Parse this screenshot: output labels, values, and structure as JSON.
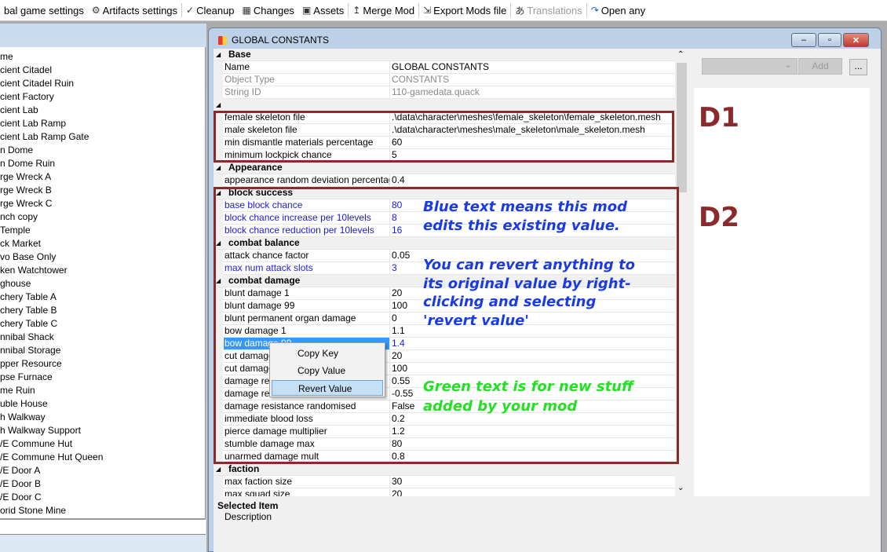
{
  "toolbar": [
    {
      "label": "bal game settings",
      "icon": "settings-icon",
      "enabled": true
    },
    {
      "label": "Artifacts settings",
      "icon": "artifact-icon",
      "enabled": true
    },
    {
      "label": "Cleanup",
      "icon": "broom-icon",
      "enabled": true
    },
    {
      "label": "Changes",
      "icon": "changes-icon",
      "enabled": true
    },
    {
      "label": "Assets",
      "icon": "assets-icon",
      "enabled": true
    },
    {
      "label": "Merge Mod",
      "icon": "merge-icon",
      "enabled": true
    },
    {
      "label": "Export Mods file",
      "icon": "export-icon",
      "enabled": true
    },
    {
      "label": "Translations",
      "icon": "translate-icon",
      "enabled": false
    },
    {
      "label": "Open any",
      "icon": "open-icon",
      "enabled": true
    }
  ],
  "left_list": [
    "me",
    "cient Citadel",
    "cient Citadel Ruin",
    "cient Factory",
    "cient Lab",
    "cient Lab Ramp",
    "cient Lab Ramp Gate",
    "n Dome",
    "n Dome Ruin",
    "rge Wreck A",
    "rge Wreck B",
    "rge Wreck C",
    "nch copy",
    " Temple",
    "ck Market",
    "vo Base Only",
    "ken Watchtower",
    "ghouse",
    "chery Table A",
    "chery Table B",
    "chery Table C",
    "nnibal Shack",
    "nnibal Storage",
    "pper Resource",
    "pse Furnace",
    "me Ruin",
    "uble House",
    "h Walkway",
    "h Walkway Support",
    "/E Commune Hut",
    "/E Commune Hut Queen",
    "/E Door A",
    "/E Door B",
    "/E Door C",
    "orid Stone Mine"
  ],
  "window": {
    "title": "GLOBAL CONSTANTS",
    "min": "–",
    "max": "▫",
    "close": "✕"
  },
  "grid": [
    {
      "cat": true,
      "name": "Base"
    },
    {
      "name": "Name",
      "value": "GLOBAL CONSTANTS"
    },
    {
      "name": "Object Type",
      "value": "CONSTANTS",
      "style": "gray"
    },
    {
      "name": "String ID",
      "value": "110-gamedata.quack",
      "style": "gray"
    },
    {
      "cat": true,
      "name": ""
    },
    {
      "name": "female skeleton file",
      "value": ".\\data\\character\\meshes\\female_skeleton\\female_skeleton.mesh"
    },
    {
      "name": "male skeleton file",
      "value": ".\\data\\character\\meshes\\male_skeleton\\male_skeleton.mesh"
    },
    {
      "name": "min dismantle materials percentage",
      "value": "60"
    },
    {
      "name": "minimum lockpick chance",
      "value": "5"
    },
    {
      "cat": true,
      "name": "Appearance"
    },
    {
      "name": "appearance random deviation percentage",
      "value": "0.4"
    },
    {
      "cat": true,
      "name": "block success"
    },
    {
      "name": "base block chance",
      "value": "80",
      "style": "blue"
    },
    {
      "name": "block chance increase per 10levels",
      "value": "8",
      "style": "blue"
    },
    {
      "name": "block chance reduction per 10levels",
      "value": "16",
      "style": "blue"
    },
    {
      "cat": true,
      "name": "combat balance"
    },
    {
      "name": "attack chance factor",
      "value": "0.05"
    },
    {
      "name": "max num attack slots",
      "value": "3",
      "style": "blue"
    },
    {
      "cat": true,
      "name": "combat damage"
    },
    {
      "name": "blunt damage 1",
      "value": "20"
    },
    {
      "name": "blunt damage 99",
      "value": "100"
    },
    {
      "name": "blunt permanent organ damage",
      "value": "0"
    },
    {
      "name": "bow damage 1",
      "value": "1.1"
    },
    {
      "name": "bow damage 99",
      "value": "1.4",
      "style": "blue",
      "selected": true
    },
    {
      "name": "cut damage",
      "value": "20"
    },
    {
      "name": "cut damage",
      "value": "100"
    },
    {
      "name": "damage resi",
      "value": "0.55"
    },
    {
      "name": "damage resi",
      "value": "-0.55"
    },
    {
      "name": "damage resistance randomised",
      "value": "False"
    },
    {
      "name": "immediate blood loss",
      "value": "0.2"
    },
    {
      "name": "pierce damage multiplier",
      "value": "1.2"
    },
    {
      "name": "stumble damage max",
      "value": "80"
    },
    {
      "name": "unarmed damage mult",
      "value": "0.8"
    },
    {
      "cat": true,
      "name": "faction"
    },
    {
      "name": "max faction size",
      "value": "30"
    },
    {
      "name": "max squad size",
      "value": "20"
    }
  ],
  "context_menu": [
    "Copy Key",
    "Copy Value",
    "Revert Value"
  ],
  "right_panel": {
    "add_label": "Add",
    "more_label": "..."
  },
  "description": {
    "title": "Selected Item",
    "text": "Description"
  },
  "annotations": {
    "d1": "D1",
    "d2": "D2",
    "blue_lines": [
      "Blue text means this mod",
      "edits this existing value."
    ],
    "revert_lines": [
      "You can revert anything to",
      "its original value by right-",
      "clicking and selecting",
      "'revert value'"
    ],
    "green_lines": [
      "Green text is for new stuff",
      "added by your mod"
    ],
    "blue_color": "#1a3ae8",
    "green_color": "#22e022",
    "red_color": "#8b2a2a"
  }
}
